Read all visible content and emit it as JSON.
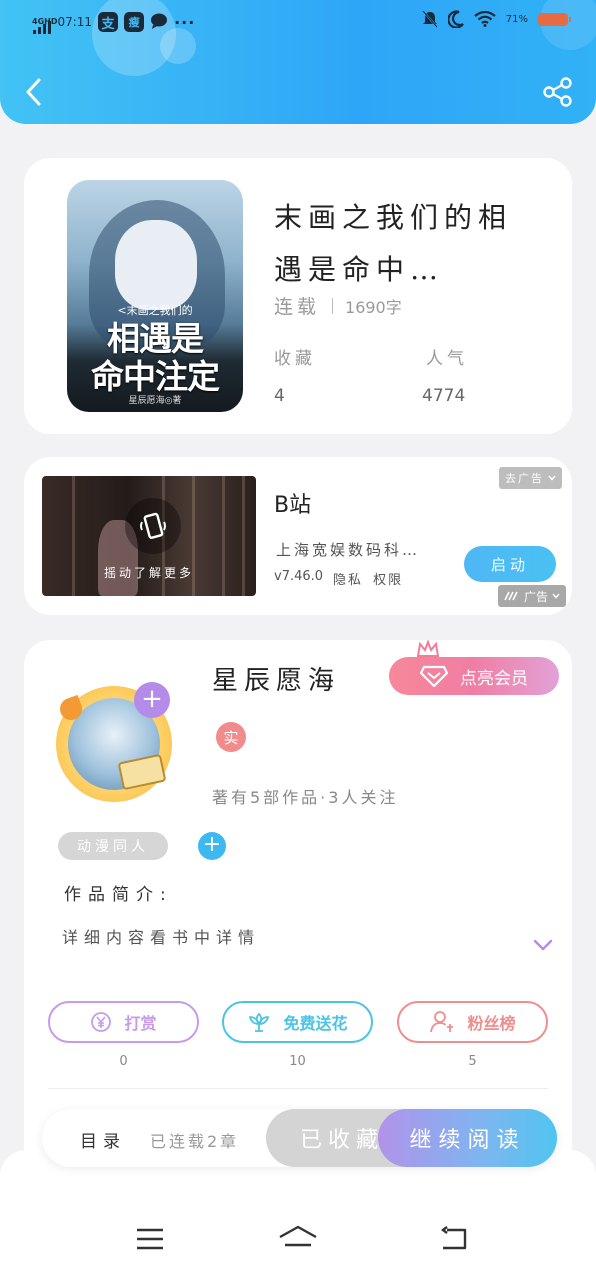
{
  "status_bar": {
    "network": "4GHD",
    "time": "07:11",
    "app_icon_1": "支",
    "app_icon_2": "瘦",
    "more": "···",
    "battery": "71%",
    "icons": [
      "signal-icon",
      "alipay-icon",
      "app-icon",
      "message-icon",
      "mute-icon",
      "moon-icon",
      "wifi-icon",
      "battery-icon"
    ]
  },
  "header": {
    "back_icon": "chevron-left-icon",
    "share_icon": "share-icon",
    "colors": {
      "start": "#42c3f4",
      "end": "#2ea6f7"
    }
  },
  "book": {
    "cover_subtitle": "<末画之我们的",
    "cover_title_line1": "相遇是",
    "cover_title_line2": "命中注定",
    "cover_author": "星辰愿海◎著",
    "title": "末画之我们的相遇是命中…",
    "status": "连载",
    "word_count": "1690字",
    "stats": [
      {
        "label": "收藏",
        "value": "4"
      },
      {
        "label": "人气",
        "value": "4774"
      }
    ]
  },
  "ad": {
    "remove_label": "去广告",
    "video_hint": "摇动了解更多",
    "title": "B站",
    "description": "上海宽娱数码科…",
    "version": "v7.46.0",
    "privacy": "隐私",
    "permission": "权限",
    "launch_label": "启动",
    "badge": "广告"
  },
  "author": {
    "name": "星辰愿海",
    "vip_label": "点亮会员",
    "real_badge": "实",
    "meta": "著有5部作品·3人关注",
    "tag": "动漫同人",
    "intro_label": "作品简介:",
    "intro_text": "详细内容看书中详情",
    "actions": [
      {
        "label": "打赏",
        "count": "0",
        "icon": "yen-icon",
        "color": "#c79be8"
      },
      {
        "label": "免费送花",
        "count": "10",
        "icon": "flower-icon",
        "color": "#49c4e4"
      },
      {
        "label": "粉丝榜",
        "count": "5",
        "icon": "user-ranking-icon",
        "color": "#ef8e8e"
      }
    ]
  },
  "read_bar": {
    "toc_label": "目录",
    "chapters": "已连载2章",
    "collected_label": "已收藏",
    "continue_label": "继续阅读"
  },
  "nav": {
    "menu_icon": "menu-icon",
    "home_icon": "home-icon",
    "back_icon": "back-icon"
  }
}
